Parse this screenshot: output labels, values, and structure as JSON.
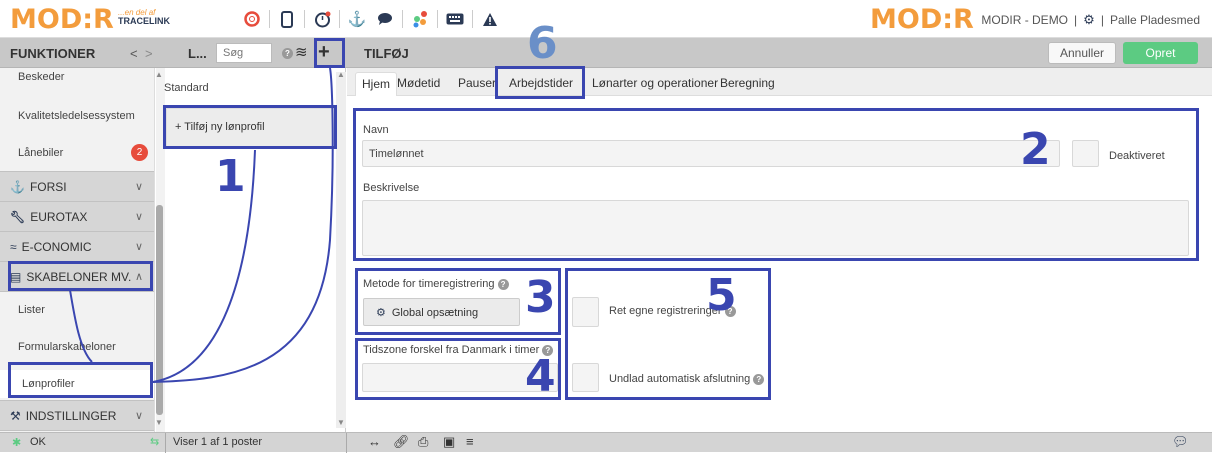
{
  "header": {
    "logo_text": "MOD:R",
    "tagline_1": "...en del af",
    "tagline_2": "TRACELINK",
    "right_logo_text": "MOD:R",
    "company": "MODIR - DEMO",
    "separator": "|",
    "user": "Palle Pladesmed",
    "icons": [
      "lifebuoy-icon",
      "mobile-icon",
      "stopwatch-icon",
      "anchor-icon",
      "chat-icon",
      "color-dots-icon",
      "keyboard-icon",
      "warning-icon",
      "gear-icon"
    ]
  },
  "left_bar": {
    "title": "FUNKTIONER",
    "nav_prev": "<",
    "nav_next": ">",
    "list_title": "L...",
    "search_placeholder": "Søg",
    "help": "?",
    "add": "+"
  },
  "sidebar": {
    "items": [
      {
        "label": "Beskeder"
      },
      {
        "label": "Kvalitetsledelsessystem"
      },
      {
        "label": "Lånebiler",
        "badge": "2"
      }
    ],
    "sections": [
      {
        "label": "FORSI",
        "icon": "anchor-icon",
        "chevron": "∨"
      },
      {
        "label": "EUROTAX",
        "icon": "wrench-icon",
        "chevron": "∨"
      },
      {
        "label": "E-CONOMIC",
        "icon": "chart-icon",
        "chevron": "∨"
      },
      {
        "label": "SKABELONER MV.",
        "icon": "document-icon",
        "chevron": "∧"
      }
    ],
    "sub_items": [
      {
        "label": "Lister"
      },
      {
        "label": "Formularskabeloner"
      },
      {
        "label": "Lønprofiler"
      }
    ],
    "bottom_section": {
      "label": "INDSTILLINGER",
      "icon": "tools-icon",
      "chevron": "∨"
    }
  },
  "list": {
    "items": [
      "Standard"
    ],
    "add_item": "+ Tilføj ny lønprofil"
  },
  "main": {
    "title": "TILFØJ",
    "cancel_label": "Annuller",
    "create_label": "Opret",
    "tabs": [
      "Hjem",
      "Mødetid",
      "Pauser",
      "Arbejdstider",
      "Lønarter og operationer",
      "Beregning"
    ],
    "active_tab": "Hjem",
    "name_label": "Navn",
    "name_value": "Timelønnet",
    "deactivated_label": "Deaktiveret",
    "description_label": "Beskrivelse",
    "description_value": "",
    "method_label": "Metode for timeregistrering",
    "method_button": "Global opsætning",
    "timezone_label": "Tidszone forskel fra Danmark i timer",
    "timezone_value": "",
    "own_reg_label": "Ret egne registreringer",
    "auto_close_label": "Undlad automatisk afslutning",
    "help": "?"
  },
  "annotations": [
    "1",
    "2",
    "3",
    "4",
    "5",
    "6"
  ],
  "statusbar": {
    "ok": "OK",
    "records": "Viser 1 af 1 poster"
  },
  "colors": {
    "brand_orange": "#f39c3c",
    "annotation_blue": "#3a46b0",
    "create_green": "#5ccb82",
    "badge_red": "#e74c3c"
  }
}
